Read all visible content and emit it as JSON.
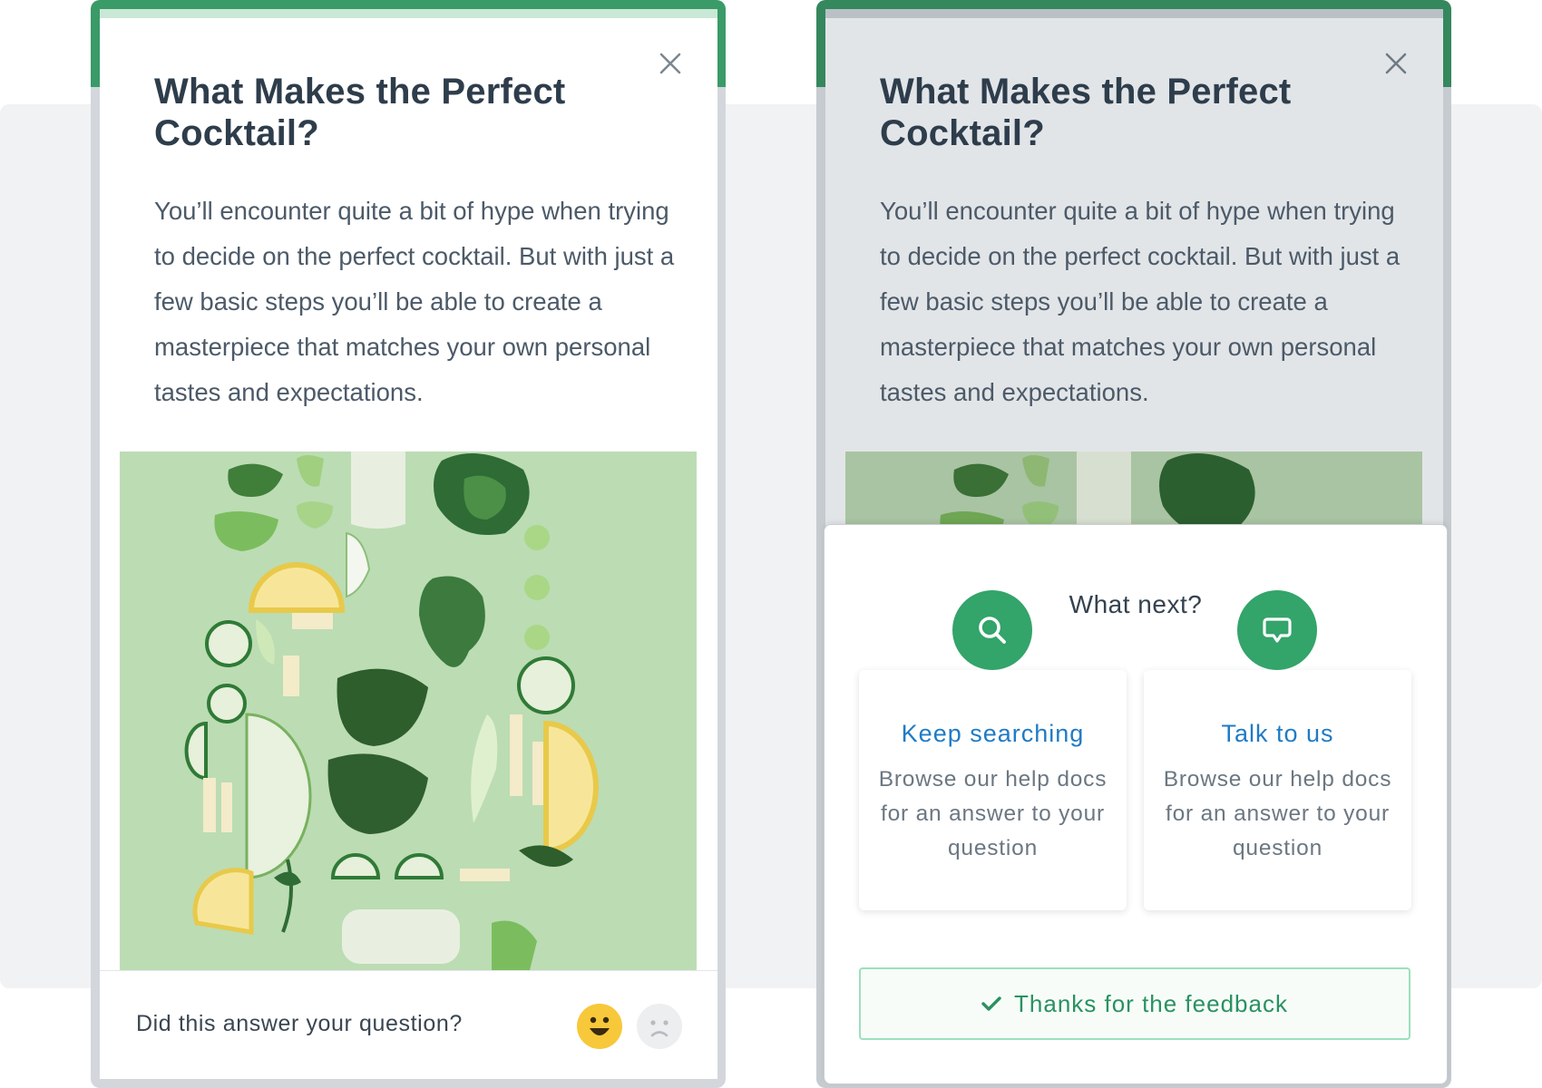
{
  "article": {
    "title": "What Makes the Perfect Cocktail?",
    "body": "You’ll encounter quite a bit of hype when trying to decide on the perfect cocktail. But with just a few basic steps you’ll be able to create a masterpiece that matches your own personal tastes and expectations.",
    "photo_icon": "green-vegetables-photo"
  },
  "feedback_prompt": {
    "question": "Did this answer your question?",
    "positive_icon": "happy-face-icon",
    "negative_icon": "sad-face-icon"
  },
  "next_steps": {
    "title": "What next?",
    "options": [
      {
        "icon": "search-icon",
        "label": "Keep searching",
        "description": "Browse our help docs for an answer to your question"
      },
      {
        "icon": "chat-bubble-icon",
        "label": "Talk to us",
        "description": "Browse our help docs for an answer to your question"
      }
    ],
    "confirmation": "Thanks for the feedback",
    "confirmation_icon": "checkmark-icon"
  },
  "colors": {
    "accent_green": "#33a46a",
    "frame_green": "#3a9a68",
    "link_blue": "#1f7bc6",
    "emoji_yellow": "#f7c83a"
  }
}
